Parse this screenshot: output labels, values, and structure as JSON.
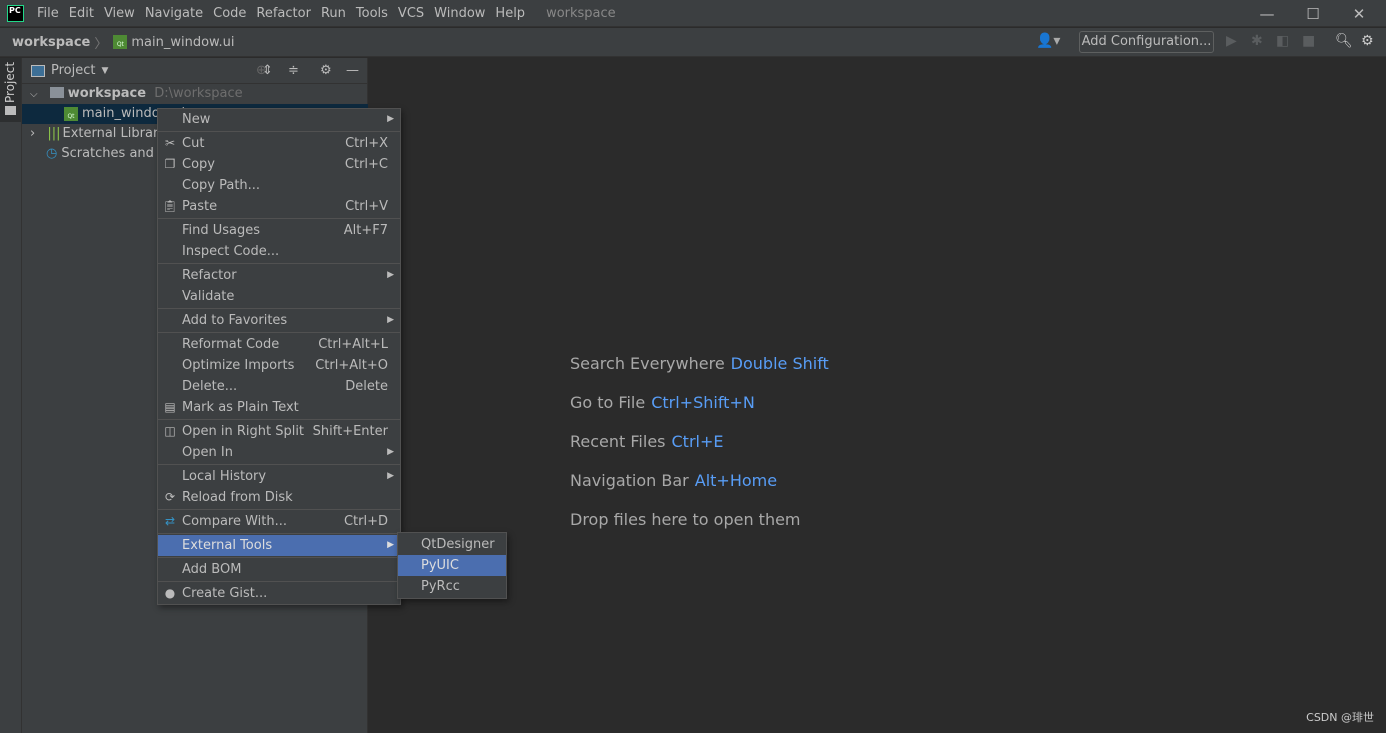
{
  "app": {
    "logo": "PC",
    "window_title": "workspace"
  },
  "menubar": [
    "File",
    "Edit",
    "View",
    "Navigate",
    "Code",
    "Refactor",
    "Run",
    "Tools",
    "VCS",
    "Window",
    "Help"
  ],
  "navbar": {
    "crumbs": [
      "workspace",
      "main_window.ui"
    ],
    "add_configuration": "Add Configuration..."
  },
  "sidebar": {
    "tab": "Project"
  },
  "project": {
    "title": "Project",
    "root": {
      "name": "workspace",
      "path": "D:\\workspace"
    },
    "items": [
      "main_window.ui",
      "External Libraries",
      "Scratches and Consoles"
    ]
  },
  "context_menu": [
    [
      {
        "label": "New",
        "submenu": true
      }
    ],
    [
      {
        "label": "Cut",
        "shortcut": "Ctrl+X",
        "icon": "scissors-icon"
      },
      {
        "label": "Copy",
        "shortcut": "Ctrl+C",
        "icon": "copy-icon"
      },
      {
        "label": "Copy Path..."
      },
      {
        "label": "Paste",
        "shortcut": "Ctrl+V",
        "icon": "paste-icon"
      }
    ],
    [
      {
        "label": "Find Usages",
        "shortcut": "Alt+F7"
      },
      {
        "label": "Inspect Code..."
      }
    ],
    [
      {
        "label": "Refactor",
        "submenu": true
      },
      {
        "label": "Validate"
      }
    ],
    [
      {
        "label": "Add to Favorites",
        "submenu": true
      }
    ],
    [
      {
        "label": "Reformat Code",
        "shortcut": "Ctrl+Alt+L"
      },
      {
        "label": "Optimize Imports",
        "shortcut": "Ctrl+Alt+O"
      },
      {
        "label": "Delete...",
        "shortcut": "Delete"
      },
      {
        "label": "Mark as Plain Text",
        "icon": "plain-text-icon"
      }
    ],
    [
      {
        "label": "Open in Right Split",
        "shortcut": "Shift+Enter",
        "icon": "split-icon"
      },
      {
        "label": "Open In",
        "submenu": true
      }
    ],
    [
      {
        "label": "Local History",
        "submenu": true
      },
      {
        "label": "Reload from Disk",
        "icon": "reload-icon"
      }
    ],
    [
      {
        "label": "Compare With...",
        "shortcut": "Ctrl+D",
        "icon": "compare-icon"
      }
    ],
    [
      {
        "label": "External Tools",
        "submenu": true,
        "highlighted": true
      }
    ],
    [
      {
        "label": "Add BOM"
      }
    ],
    [
      {
        "label": "Create Gist...",
        "icon": "github-icon"
      }
    ]
  ],
  "submenu": [
    {
      "label": "QtDesigner"
    },
    {
      "label": "PyUIC",
      "highlighted": true
    },
    {
      "label": "PyRcc"
    }
  ],
  "editor_hints": [
    {
      "label": "Search Everywhere",
      "key": "Double Shift"
    },
    {
      "label": "Go to File",
      "key": "Ctrl+Shift+N"
    },
    {
      "label": "Recent Files",
      "key": "Ctrl+E"
    },
    {
      "label": "Navigation Bar",
      "key": "Alt+Home"
    },
    {
      "label": "Drop files here to open them",
      "key": ""
    }
  ],
  "watermark": "CSDN @琲世",
  "colors": {
    "highlight": "#4b6eaf",
    "link": "#589df6",
    "selection": "#0d293e"
  }
}
